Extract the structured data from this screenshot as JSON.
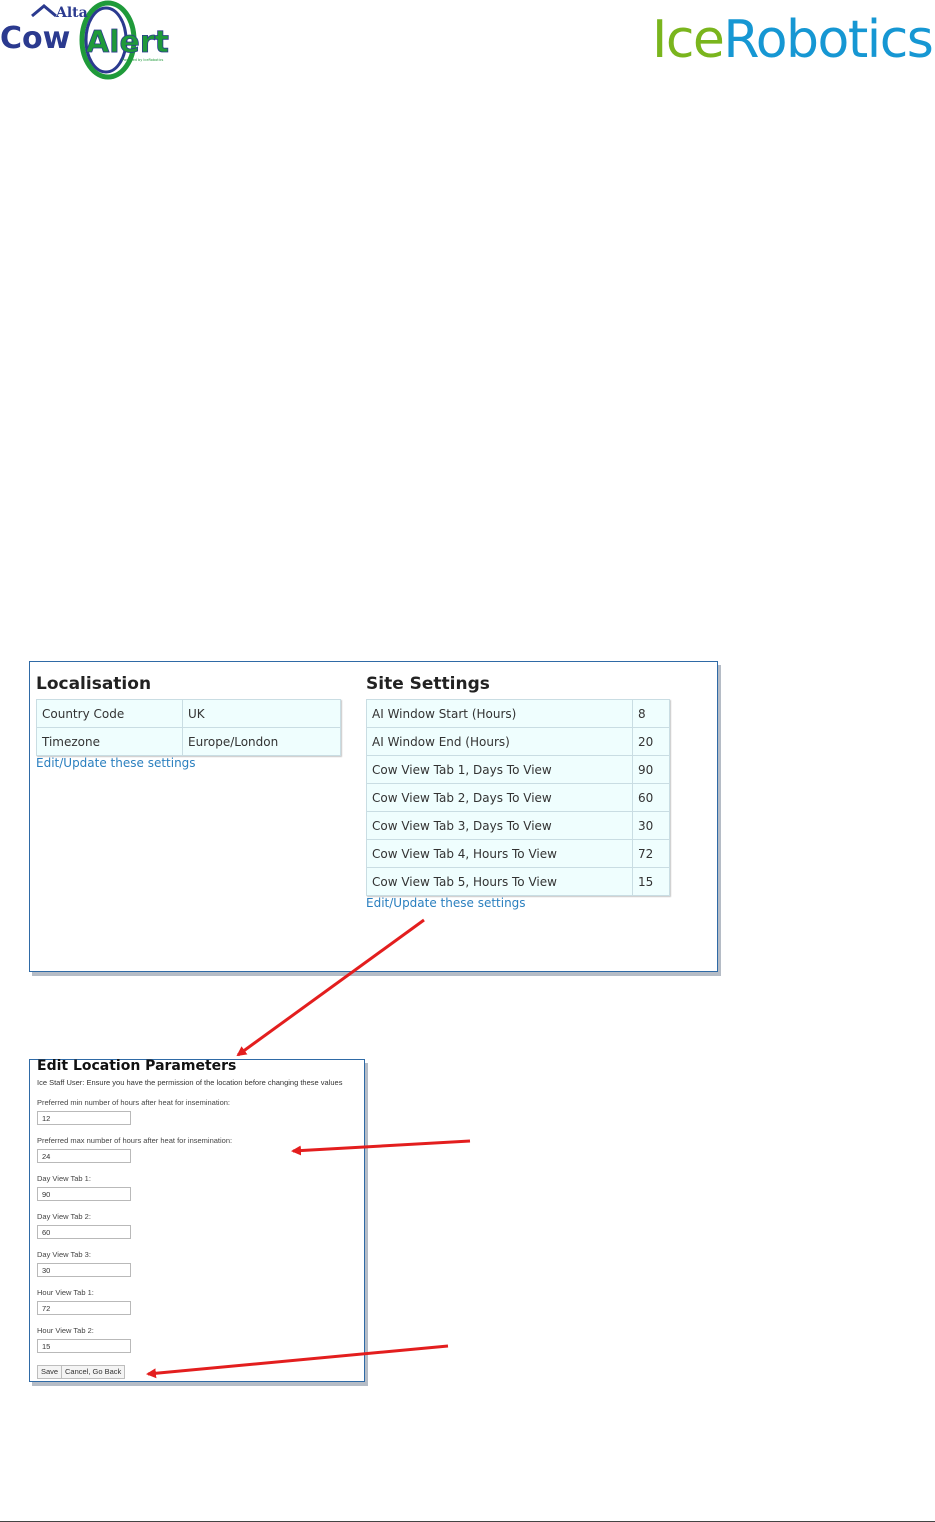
{
  "header": {
    "cowalert_logo": {
      "small_text": "Alta",
      "main_text_1": "Cow",
      "main_text_2": "Alert",
      "tagline": "Powered by IceRobotics"
    },
    "icerobotics_logo": {
      "part1": "Ice",
      "part2": "Robotics"
    }
  },
  "localisation": {
    "title": "Localisation",
    "rows": [
      {
        "label": "Country Code",
        "value": "UK"
      },
      {
        "label": "Timezone",
        "value": "Europe/London"
      }
    ],
    "edit_link": "Edit/Update these settings"
  },
  "site_settings": {
    "title": "Site Settings",
    "rows": [
      {
        "label": "AI Window Start (Hours)",
        "value": "8"
      },
      {
        "label": "AI Window End (Hours)",
        "value": "20"
      },
      {
        "label": "Cow View Tab 1, Days To View",
        "value": "90"
      },
      {
        "label": "Cow View Tab 2, Days To View",
        "value": "60"
      },
      {
        "label": "Cow View Tab 3, Days To View",
        "value": "30"
      },
      {
        "label": "Cow View Tab 4, Hours To View",
        "value": "72"
      },
      {
        "label": "Cow View Tab 5, Hours To View",
        "value": "15"
      }
    ],
    "edit_link": "Edit/Update these settings"
  },
  "edit_form": {
    "title": "Edit Location Parameters",
    "warning": "Ice Staff User: Ensure you have the permission of the location before changing these values",
    "fields": [
      {
        "label": "Preferred min number of hours after heat for insemination:",
        "value": "12"
      },
      {
        "label": "Preferred max number of hours after heat for insemination:",
        "value": "24"
      },
      {
        "label": "Day View Tab 1:",
        "value": "90"
      },
      {
        "label": "Day View Tab 2:",
        "value": "60"
      },
      {
        "label": "Day View Tab 3:",
        "value": "30"
      },
      {
        "label": "Hour View Tab 1:",
        "value": "72"
      },
      {
        "label": "Hour View Tab 2:",
        "value": "15"
      }
    ],
    "save_label": "Save",
    "cancel_label": "Cancel, Go Back"
  },
  "colors": {
    "arrow": "#e31e1e",
    "panel_border": "#2f6aa6",
    "cell_background": "#effefe",
    "link": "#2a7fbf",
    "ice_green": "#7ab51d",
    "robotics_blue": "#1697d3"
  }
}
